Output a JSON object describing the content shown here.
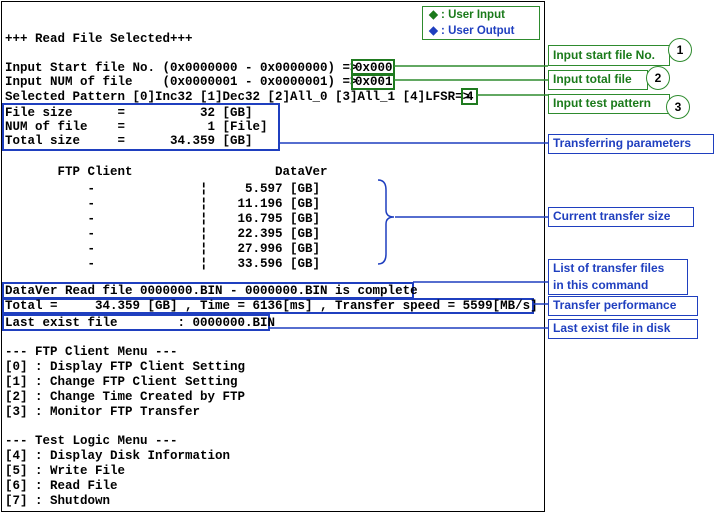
{
  "legend": {
    "user_input": "◆ : User Input",
    "user_output": "◆ : User Output"
  },
  "terminal": {
    "header": "+++ Read File Selected+++",
    "start_line": "Input Start file No. (0x0000000 - 0x0000000) =>",
    "start_value": "0x000",
    "num_line": "Input NUM of file    (0x0000001 - 0x0000001) =>",
    "num_value": "0x001",
    "pattern_line": "Selected Pattern [0]Inc32 [1]Dec32 [2]All_0 [3]All_1 [4]LFSR=>",
    "pattern_value": "4",
    "file_size": "File size      =          32 [GB]",
    "num_of_file": "NUM of file    =           1 [File]",
    "total_size": "Total size     =      34.359 [GB]",
    "col_header": "       FTP Client                   DataVer",
    "rows": [
      "           -              ¦     5.597 [GB]",
      "           -              ¦    11.196 [GB]",
      "           -              ¦    16.795 [GB]",
      "           -              ¦    22.395 [GB]",
      "           -              ¦    27.996 [GB]",
      "           -              ¦    33.596 [GB]"
    ],
    "complete_line": "DataVer Read file 0000000.BIN - 0000000.BIN is complete",
    "perf_line": "Total =     34.359 [GB] , Time = 6136[ms] , Transfer speed = 5599[MB/s]",
    "last_exist": "Last exist file        : 0000000.BIN",
    "ftp_menu_title": "--- FTP Client Menu ---",
    "ftp_menu": [
      "[0] : Display FTP Client Setting",
      "[1] : Change FTP Client Setting",
      "[2] : Change Time Created by FTP",
      "[3] : Monitor FTP Transfer"
    ],
    "test_menu_title": "--- Test Logic Menu ---",
    "test_menu": [
      "[4] : Display Disk Information",
      "[5] : Write File",
      "[6] : Read File",
      "[7] : Shutdown"
    ]
  },
  "labels": {
    "start": "Input start file No.",
    "total": "Input total file",
    "pattern": "Input test pattern",
    "params": "Transferring parameters",
    "current": "Current transfer size",
    "list_line1": "List of transfer files",
    "list_line2": "in this command",
    "perf": "Transfer performance",
    "last": "Last exist file in disk"
  },
  "circles": [
    "1",
    "2",
    "3"
  ],
  "colors": {
    "green": "#2e8b2e",
    "blue": "#1f3fbf",
    "green_diamond": "#1a7a1a"
  }
}
